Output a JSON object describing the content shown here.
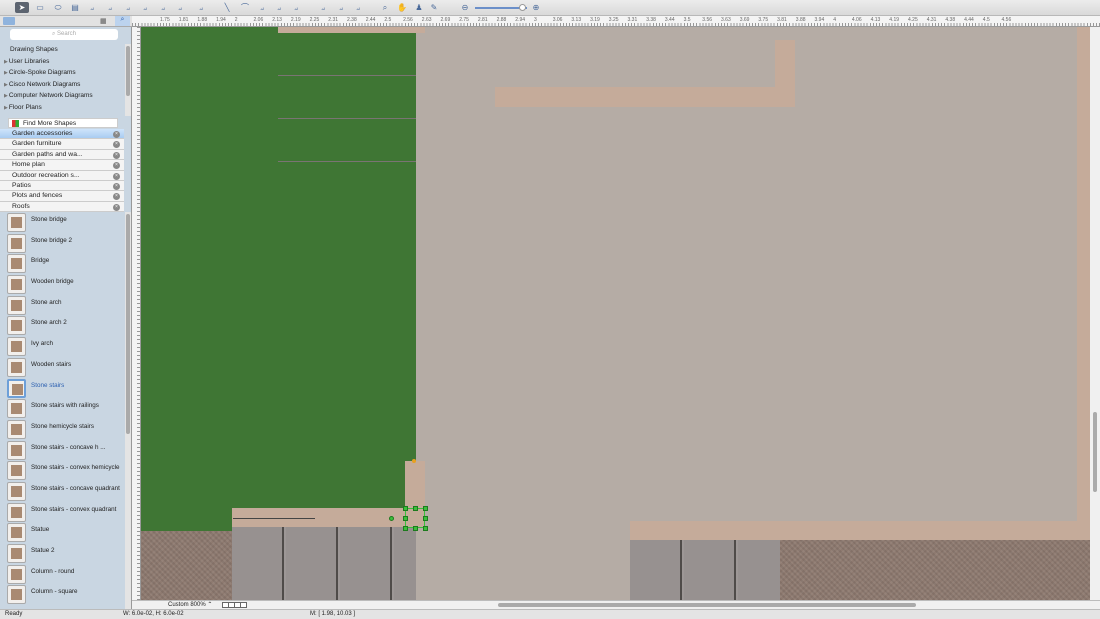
{
  "toolbar": {
    "tools": [
      "select-icon",
      "rectangle-icon",
      "ellipse-icon",
      "container-icon",
      "connector-icon",
      "curved-connector-icon",
      "tree-connector-icon",
      "orthogonal-connector-icon",
      "smart-connector-icon",
      "multi-connector-icon",
      "insert-icon",
      "line-icon",
      "arc-icon",
      "polyline-icon",
      "bezier-icon",
      "spline-icon",
      "group-icon",
      "align-icon",
      "arrange-icon",
      "zoom-tool-icon",
      "pan-icon",
      "stamp-icon",
      "eyedropper-icon"
    ],
    "zoom_level": 0.92
  },
  "sidebar": {
    "search_placeholder": "Search",
    "tree": [
      {
        "label": "Drawing Shapes",
        "expandable": false
      },
      {
        "label": "User Libraries",
        "expandable": true
      },
      {
        "label": "Circle-Spoke Diagrams",
        "expandable": true
      },
      {
        "label": "Cisco Network Diagrams",
        "expandable": true
      },
      {
        "label": "Computer Network Diagrams",
        "expandable": true
      },
      {
        "label": "Floor Plans",
        "expandable": true
      }
    ],
    "find_more": "Find More Shapes",
    "libraries": [
      {
        "label": "Garden accessories",
        "selected": true
      },
      {
        "label": "Garden furniture"
      },
      {
        "label": "Garden paths and wa..."
      },
      {
        "label": "Home plan"
      },
      {
        "label": "Outdoor recreation s..."
      },
      {
        "label": "Patios"
      },
      {
        "label": "Plots and fences"
      },
      {
        "label": "Roofs"
      }
    ],
    "shapes": [
      {
        "label": "Stone bridge"
      },
      {
        "label": "Stone bridge 2"
      },
      {
        "label": "Bridge"
      },
      {
        "label": "Wooden bridge"
      },
      {
        "label": "Stone arch"
      },
      {
        "label": "Stone arch 2"
      },
      {
        "label": "Ivy arch"
      },
      {
        "label": "Wooden stairs"
      },
      {
        "label": "Stone stairs",
        "selected": true
      },
      {
        "label": "Stone stairs with railings"
      },
      {
        "label": "Stone hemicycle stairs"
      },
      {
        "label": "Stone stairs - concave h ..."
      },
      {
        "label": "Stone stairs - convex hemicycle"
      },
      {
        "label": "Stone stairs - concave quadrant"
      },
      {
        "label": "Stone stairs - convex quadrant"
      },
      {
        "label": "Statue"
      },
      {
        "label": "Statue 2"
      },
      {
        "label": "Column - round"
      },
      {
        "label": "Column - square"
      }
    ]
  },
  "ruler": {
    "labels": [
      "1.75",
      "1.81",
      "1.88",
      "1.94",
      "2",
      "2.06",
      "2.13",
      "2.19",
      "2.25",
      "2.31",
      "2.38",
      "2.44",
      "2.5",
      "2.56",
      "2.63",
      "2.69",
      "2.75",
      "2.81",
      "2.88",
      "2.94",
      "3",
      "3.06",
      "3.13",
      "3.19",
      "3.25",
      "3.31",
      "3.38",
      "3.44",
      "3.5",
      "3.56",
      "3.63",
      "3.69",
      "3.75",
      "3.81",
      "3.88",
      "3.94",
      "4",
      "4.06",
      "4.13",
      "4.19",
      "4.25",
      "4.31",
      "4.38",
      "4.44",
      "4.5",
      "4.56"
    ]
  },
  "bottom": {
    "zoom_label": "Custom 800%"
  },
  "status": {
    "ready": "Ready",
    "size": "W: 6.0e-02,  H: 6.0e-02",
    "mouse": "M: [ 1.98, 10.03 ]"
  },
  "colors": {
    "lawn": "#3f7634",
    "ground": "#b5aca5",
    "path": "#c5ab9a",
    "tiles": "#979190",
    "selection": "#3bbf3b"
  }
}
